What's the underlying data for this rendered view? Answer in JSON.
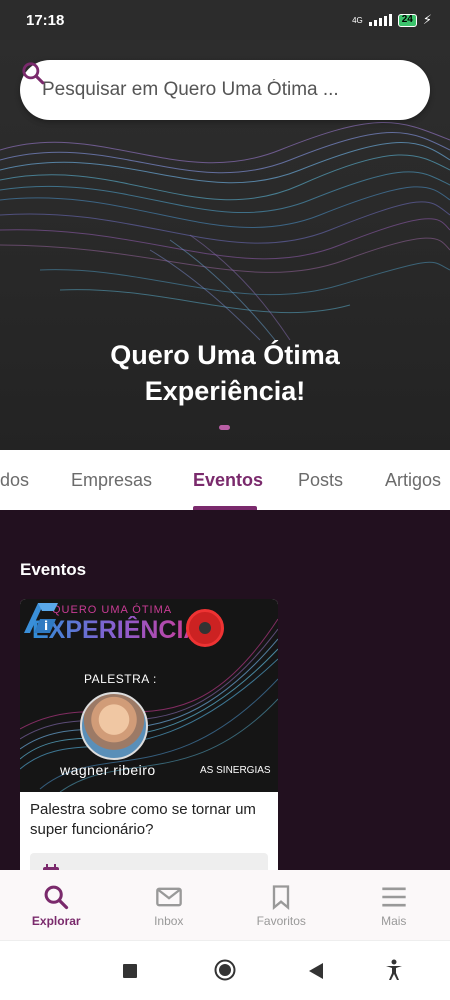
{
  "status": {
    "time": "17:18",
    "network": "4G",
    "battery": "24"
  },
  "search": {
    "placeholder": "Pesquisar em Quero Uma Ótima ..."
  },
  "hero": {
    "title_line1": "Quero Uma Ótima",
    "title_line2": "Experiência!"
  },
  "tabs": [
    {
      "label": "dos"
    },
    {
      "label": "Empresas"
    },
    {
      "label": "Eventos",
      "active": true
    },
    {
      "label": "Posts"
    },
    {
      "label": "Artigos"
    }
  ],
  "section": {
    "title": "Eventos"
  },
  "event_card": {
    "brand_small": "QUERO UMA ÓTIMA",
    "brand_big": "EXPERIÊNCIA",
    "palestra": "PALESTRA :",
    "speaker": "wagner ribeiro",
    "partner": "AS SINERGIAS",
    "title": "Palestra sobre como se tornar um super funcionário?"
  },
  "bottom_nav": [
    {
      "label": "Explorar",
      "icon": "search-icon",
      "active": true
    },
    {
      "label": "Inbox",
      "icon": "mail-icon"
    },
    {
      "label": "Favoritos",
      "icon": "bookmark-icon"
    },
    {
      "label": "Mais",
      "icon": "menu-icon"
    }
  ],
  "colors": {
    "accent": "#7a2a6c",
    "background": "#22101f"
  }
}
